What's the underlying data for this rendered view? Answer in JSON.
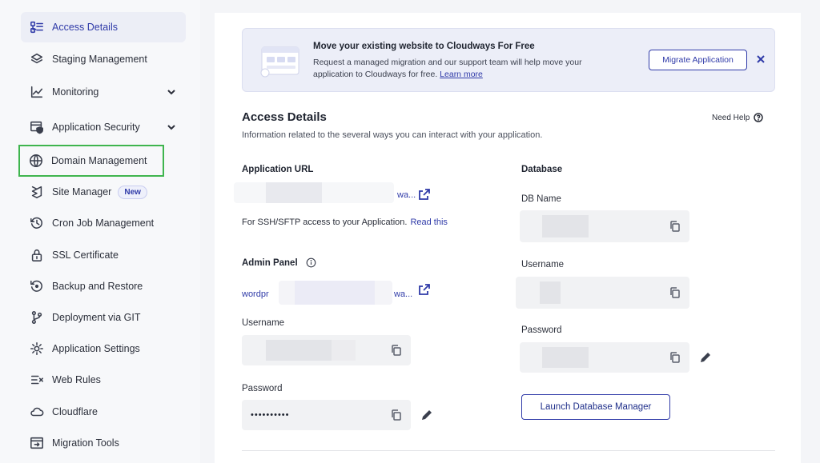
{
  "sidebar": {
    "items": [
      {
        "label": "Access Details",
        "icon": "access-details-icon"
      },
      {
        "label": "Staging Management",
        "icon": "layers-icon"
      },
      {
        "label": "Monitoring",
        "icon": "line-chart-icon"
      },
      {
        "label": "Application Security",
        "icon": "security-shield-icon"
      },
      {
        "label": "Domain Management",
        "icon": "www-globe-icon"
      },
      {
        "label": "Site Manager",
        "icon": "site-manager-icon",
        "badge": "New"
      },
      {
        "label": "Cron Job Management",
        "icon": "clock-history-icon"
      },
      {
        "label": "SSL Certificate",
        "icon": "lock-icon"
      },
      {
        "label": "Backup and Restore",
        "icon": "backup-restore-icon"
      },
      {
        "label": "Deployment via GIT",
        "icon": "git-branch-icon"
      },
      {
        "label": "Application Settings",
        "icon": "gear-icon"
      },
      {
        "label": "Web Rules",
        "icon": "rules-icon"
      },
      {
        "label": "Cloudflare",
        "icon": "cloud-icon"
      },
      {
        "label": "Migration Tools",
        "icon": "migration-icon"
      }
    ]
  },
  "banner": {
    "title": "Move your existing website to Cloudways For Free",
    "desc": "Request a managed migration and our support team will help move your application to Cloudways for free.",
    "link": "Learn more",
    "button": "Migrate Application",
    "close_icon": "close-icon"
  },
  "access": {
    "title": "Access Details",
    "desc": "Information related to the several ways you can interact with your application.",
    "need_help": "Need Help",
    "app_url_title": "Application URL",
    "app_url_suffix": "wa...",
    "ssh_note": "For SSH/SFTP access to your Application.",
    "ssh_link": "Read this",
    "admin_panel_title": "Admin Panel",
    "admin_prefix": "wordpr",
    "admin_suffix": "wa...",
    "username_label": "Username",
    "password_label": "Password",
    "password_value": "••••••••••"
  },
  "database": {
    "title": "Database",
    "db_name_label": "DB Name",
    "username_label": "Username",
    "password_label": "Password",
    "launch_button": "Launch Database Manager"
  },
  "colors": {
    "accent": "#2f3aa8",
    "highlight": "#3fb54e"
  }
}
